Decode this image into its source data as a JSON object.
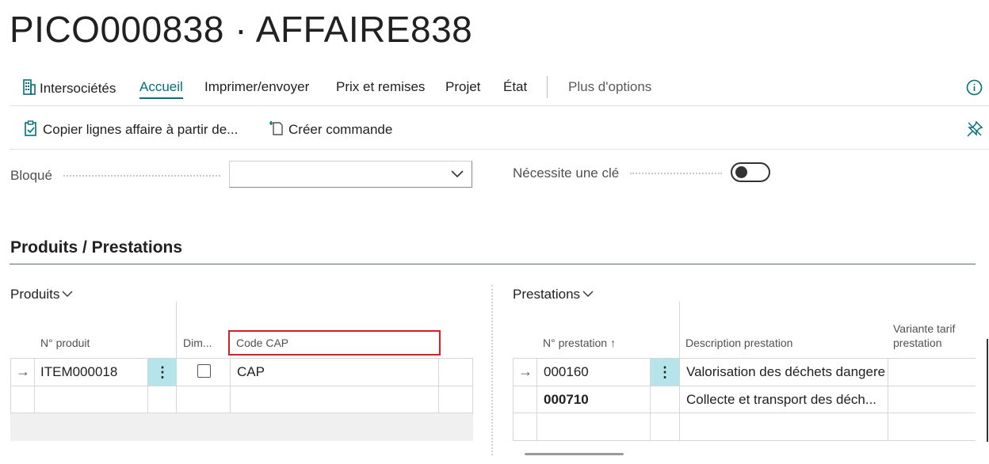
{
  "page": {
    "title": "PICO000838 · AFFAIRE838"
  },
  "actions": {
    "intersocietes": "Intersociétés",
    "accueil": "Accueil",
    "imprimer": "Imprimer/envoyer",
    "prix": "Prix et remises",
    "projet": "Projet",
    "etat": "État",
    "plus": "Plus d'options"
  },
  "subactions": {
    "copier": "Copier lignes affaire à partir de...",
    "creer": "Créer commande"
  },
  "fields": {
    "bloque_label": "Bloqué",
    "bloque_value": "",
    "cle_label": "Nécessite une clé",
    "cle_value": false
  },
  "section": {
    "title": "Produits / Prestations"
  },
  "produits": {
    "label": "Produits",
    "columns": {
      "no": "N° produit",
      "dim": "Dim...",
      "code_cap": "Code CAP"
    },
    "rows": [
      {
        "no": "ITEM000018",
        "dim": false,
        "code_cap": "CAP",
        "current": true
      },
      {
        "no": "",
        "dim": null,
        "code_cap": "",
        "current": false
      }
    ]
  },
  "prestations": {
    "label": "Prestations",
    "columns": {
      "no": "N° prestation",
      "sort": "↑",
      "description": "Description prestation",
      "variante_1": "Variante tarif",
      "variante_2": "prestation"
    },
    "rows": [
      {
        "no": "000160",
        "description": "Valorisation des déchets dangere",
        "current": true
      },
      {
        "no": "000710",
        "description": "Collecte et transport des déch...",
        "current": false
      }
    ]
  },
  "colors": {
    "accent": "#00707a",
    "highlight": "#b5e5ea",
    "red_box": "#d61f26"
  }
}
